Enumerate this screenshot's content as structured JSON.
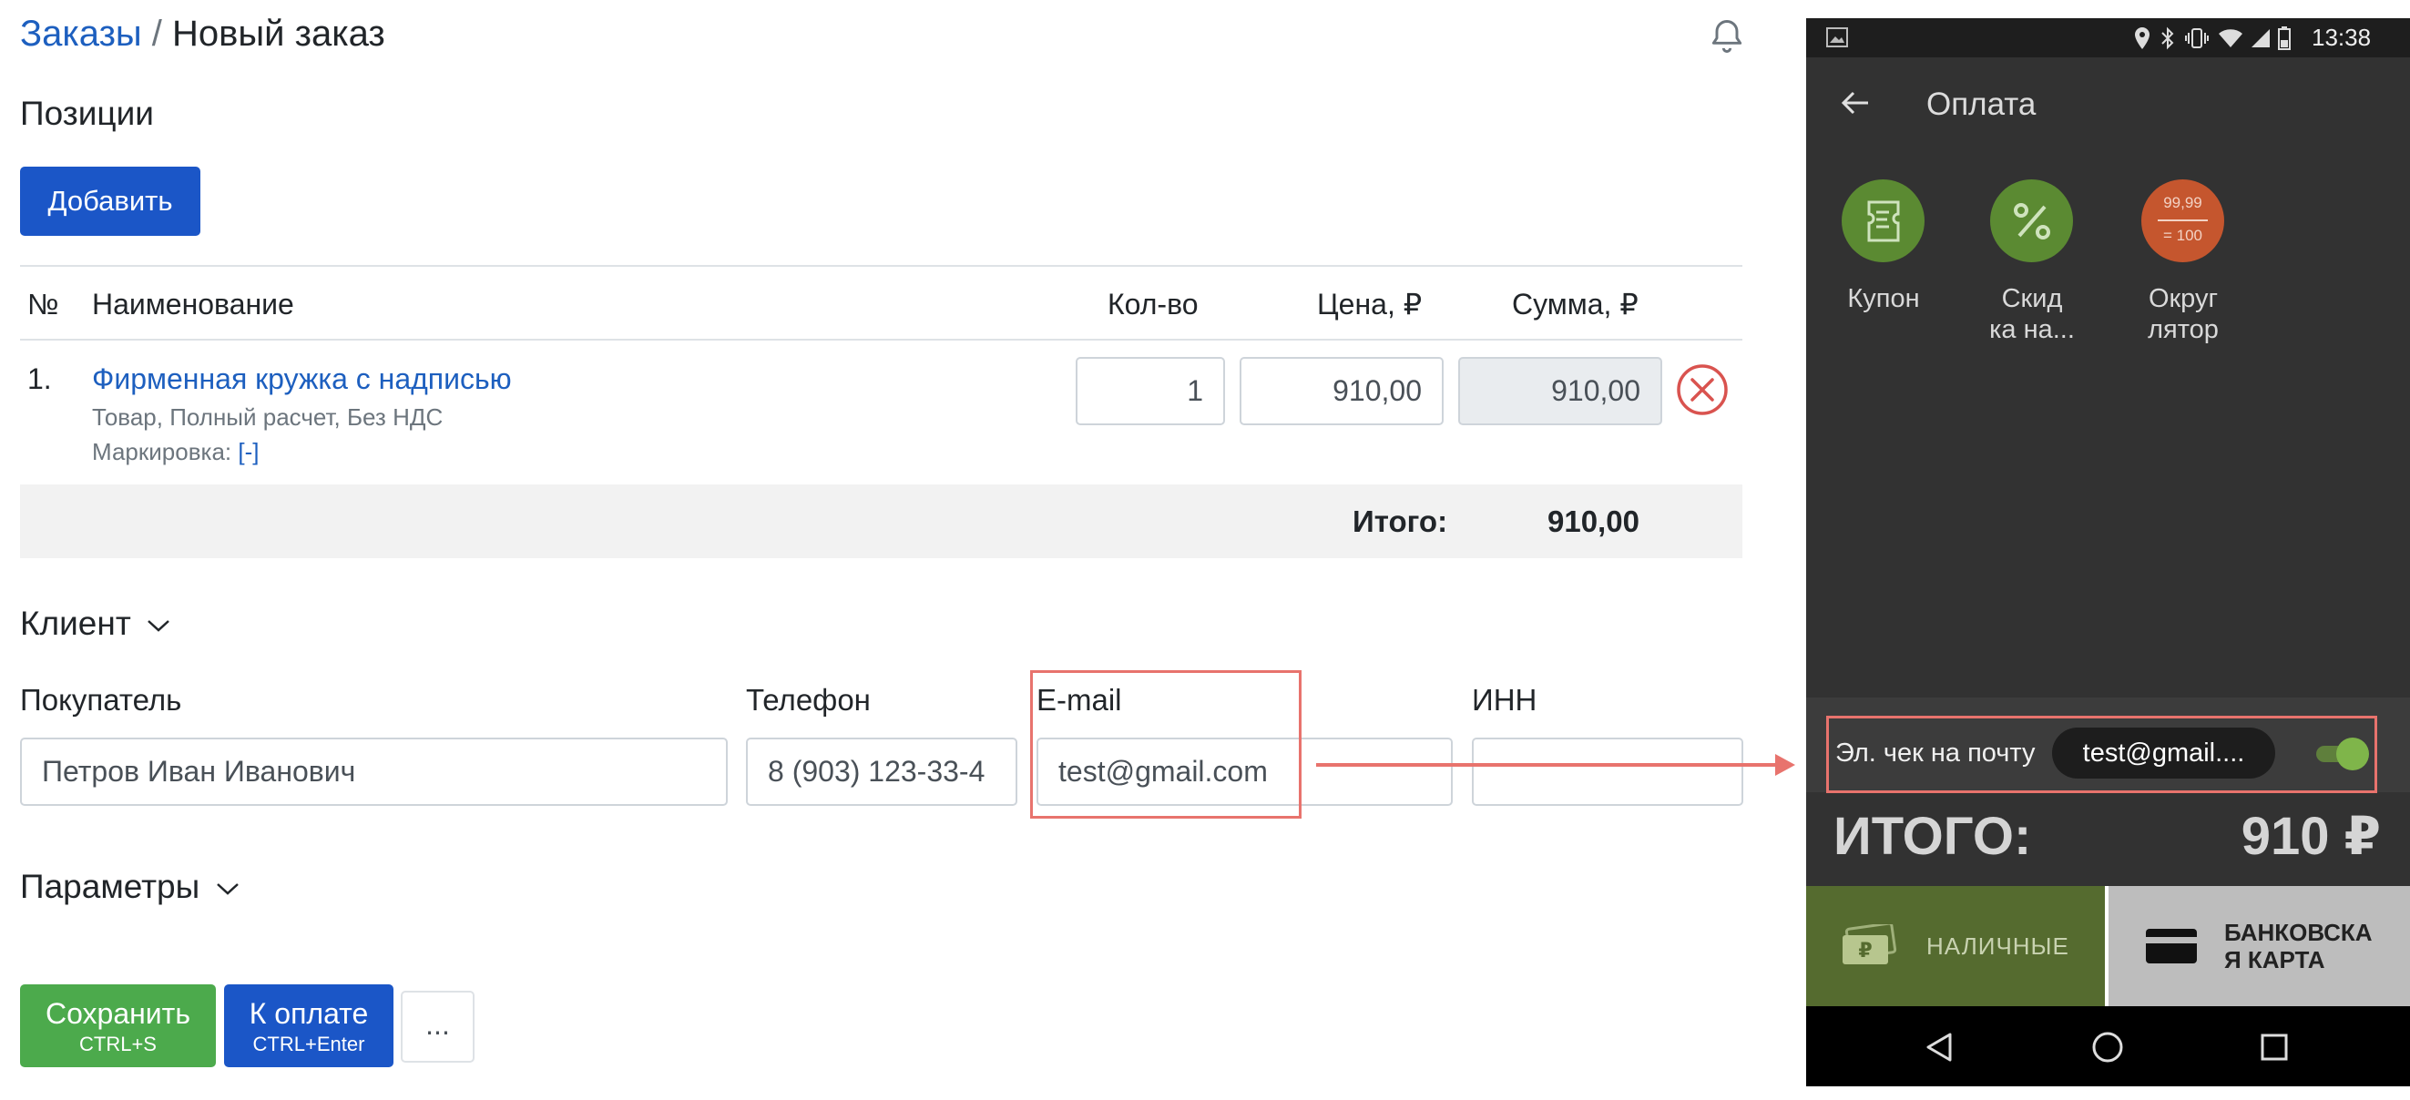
{
  "breadcrumb": {
    "parent": "Заказы",
    "separator": "/",
    "current": "Новый заказ"
  },
  "positions": {
    "title": "Позиции",
    "add_label": "Добавить",
    "columns": {
      "num": "№",
      "name": "Наименование",
      "qty": "Кол-во",
      "price": "Цена, ₽",
      "sum": "Сумма, ₽"
    },
    "rows": [
      {
        "num": "1.",
        "name": "Фирменная кружка с надписью",
        "meta": "Товар, Полный расчет, Без НДС",
        "marking_label": "Маркировка:",
        "marking_link": "[-]",
        "qty": "1",
        "price": "910,00",
        "sum": "910,00"
      }
    ],
    "total_label": "Итого:",
    "total_value": "910,00"
  },
  "client": {
    "title": "Клиент",
    "buyer_label": "Покупатель",
    "buyer_value": "Петров Иван Иванович",
    "phone_label": "Телефон",
    "phone_value": "8 (903) 123-33-4",
    "email_label": "E-mail",
    "email_value": "test@gmail.com",
    "inn_label": "ИНН",
    "inn_value": ""
  },
  "params": {
    "title": "Параметры"
  },
  "actions": {
    "save_label": "Сохранить",
    "save_shortcut": "CTRL+S",
    "pay_label": "К оплате",
    "pay_shortcut": "CTRL+Enter",
    "more_label": "..."
  },
  "phone": {
    "time": "13:38",
    "title": "Оплата",
    "tiles": [
      {
        "label_line1": "Купон",
        "label_line2": "",
        "icon": "coupon-icon",
        "color": "#5b8a32"
      },
      {
        "label_line1": "Скид",
        "label_line2": "ка на...",
        "icon": "percent-icon",
        "color": "#5b8a32"
      },
      {
        "label_line1": "Округ",
        "label_line2": "лятор",
        "icon": "rounding-icon",
        "color": "#c5562e",
        "icon_top": "99,99",
        "icon_bottom": "= 100"
      }
    ],
    "receipt_label": "Эл. чек на почту",
    "receipt_email": "test@gmail....",
    "receipt_toggle_on": true,
    "total_label": "ИТОГО:",
    "total_value": "910 ₽",
    "cash_label": "НАЛИЧНЫЕ",
    "card_label_line1": "БАНКОВСКА",
    "card_label_line2": "Я КАРТА",
    "colors": {
      "accent_green": "#5b8a32",
      "cash_bg": "#556b2f",
      "card_bg": "#bdbdbd",
      "highlight": "#e8736d"
    }
  }
}
